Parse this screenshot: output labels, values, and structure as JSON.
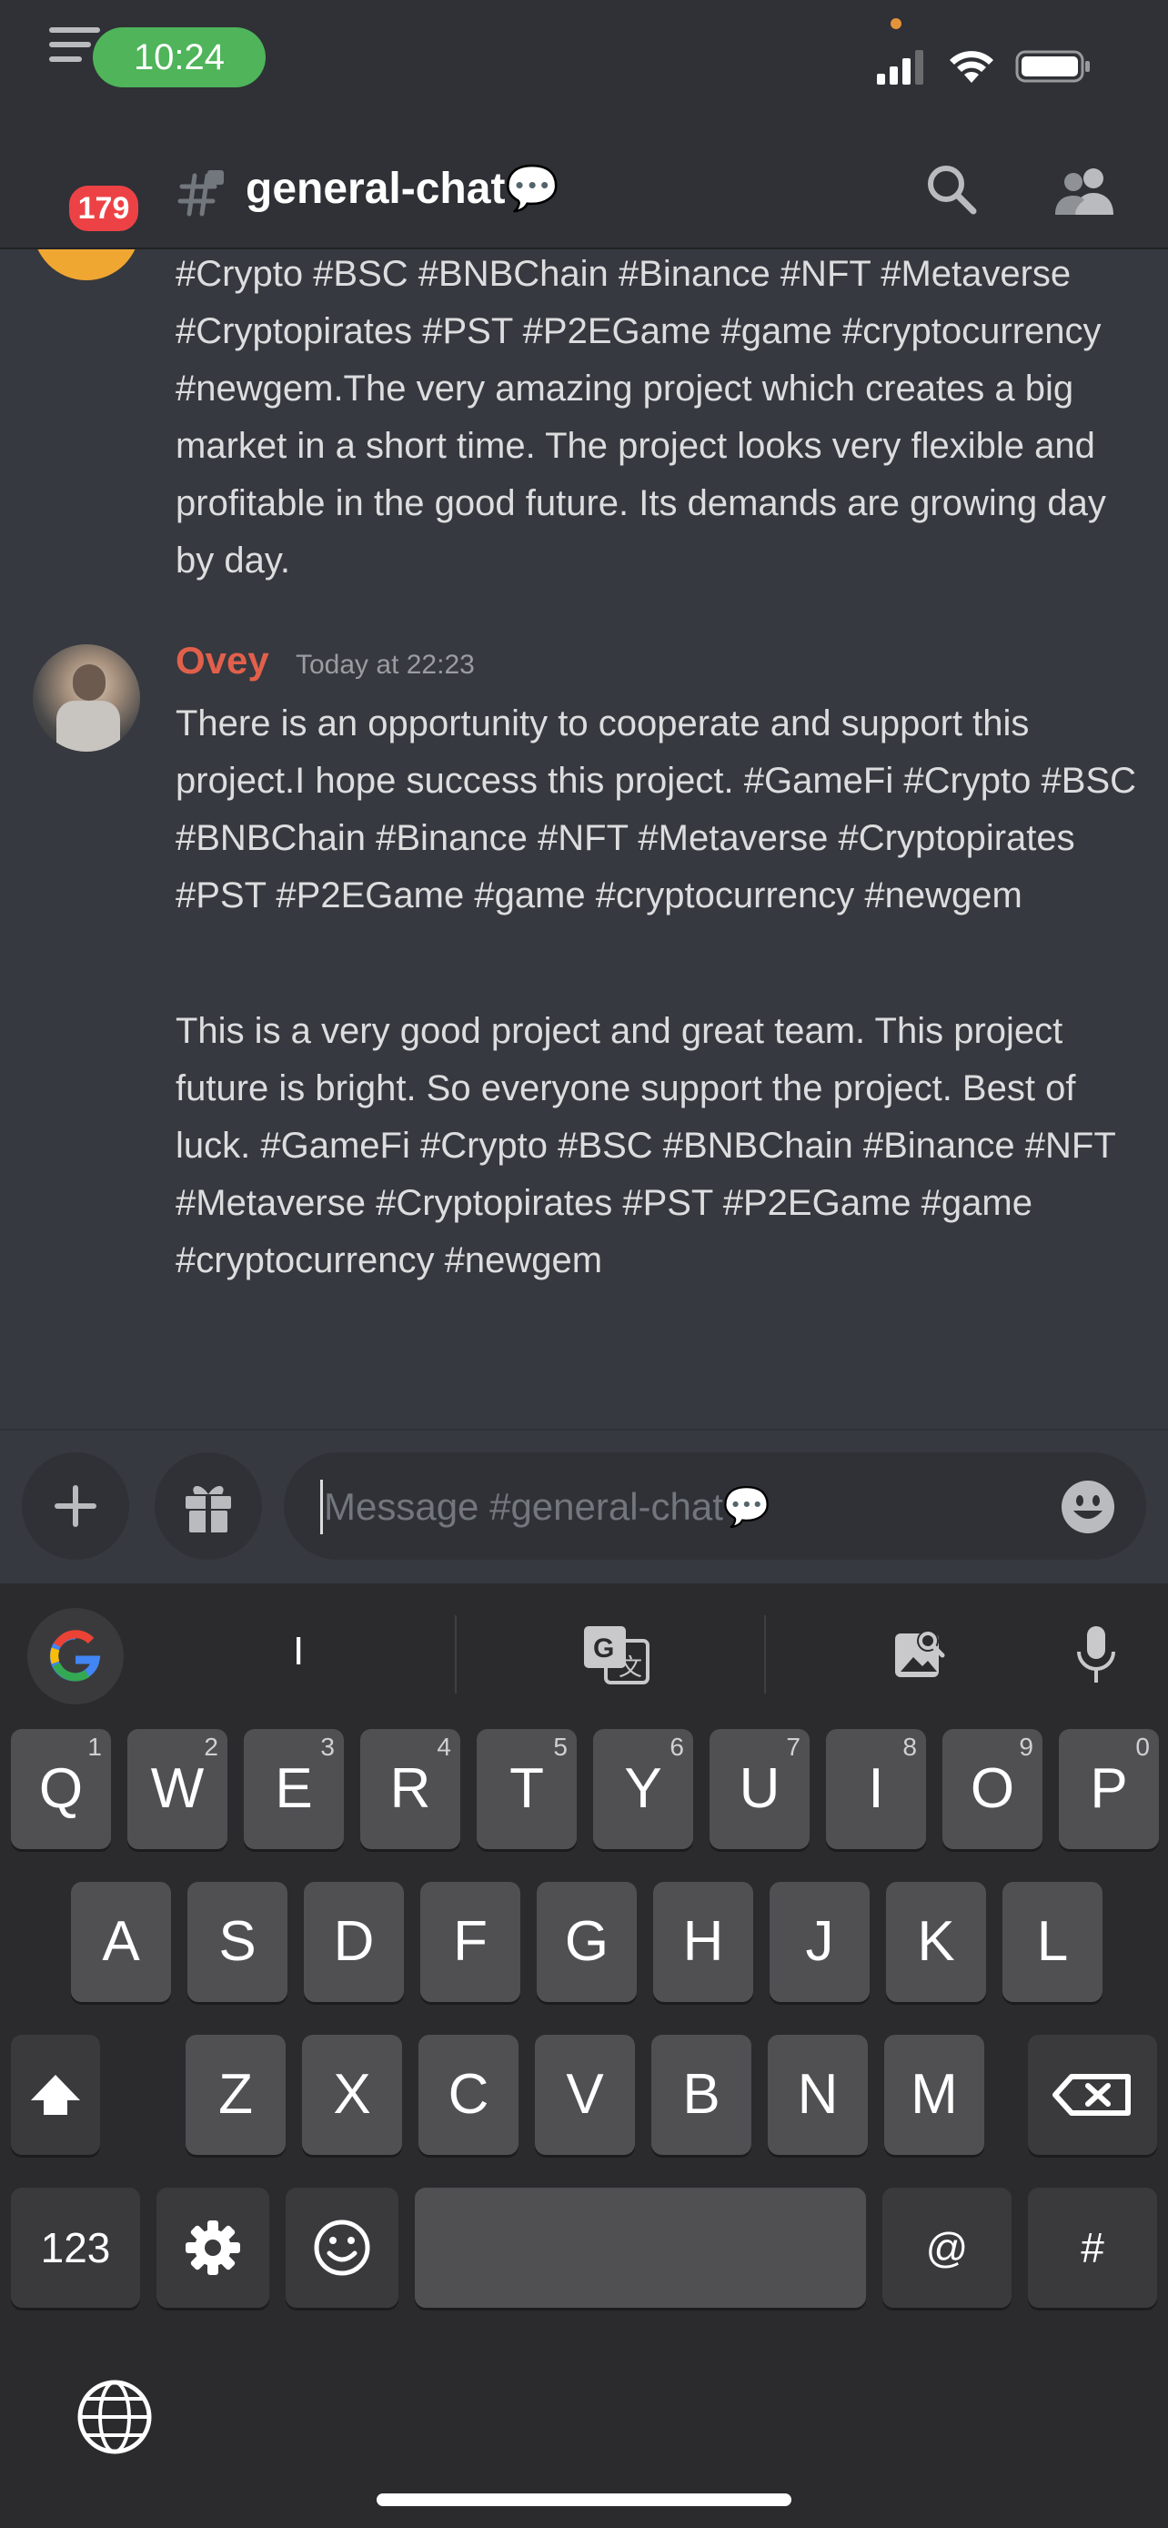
{
  "status_bar": {
    "time": "10:24"
  },
  "header": {
    "unread_badge": "179",
    "channel_name": "general-chat💬"
  },
  "messages": {
    "partial_top_text": "#Crypto #BSC #BNBChain #Binance   #NFT #Metaverse #Cryptopirates #PST #P2EGame #game #cryptocurrency #newgem.The very amazing project which creates a big market in a short time. The project looks very flexible and profitable in the good future. Its demands are growing day by day.",
    "ovey": {
      "author": "Ovey",
      "timestamp": "Today at 22:23",
      "text_1": "There is an opportunity to cooperate and support this project.I hope success this project. #GameFi #Crypto #BSC #BNBChain #Binance #NFT #Metaverse #Cryptopirates #PST #P2EGame #game #cryptocurrency #newgem",
      "text_2": "This is a very good project and great team. This project future is bright. So everyone support the project. Best of luck. #GameFi #Crypto #BSC #BNBChain #Binance #NFT #Metaverse #Cryptopirates #PST #P2EGame #game #cryptocurrency #newgem"
    }
  },
  "composer": {
    "placeholder": "Message #general-chat💬"
  },
  "keyboard": {
    "suggestion": "I",
    "row1": [
      {
        "key": "Q",
        "num": "1"
      },
      {
        "key": "W",
        "num": "2"
      },
      {
        "key": "E",
        "num": "3"
      },
      {
        "key": "R",
        "num": "4"
      },
      {
        "key": "T",
        "num": "5"
      },
      {
        "key": "Y",
        "num": "6"
      },
      {
        "key": "U",
        "num": "7"
      },
      {
        "key": "I",
        "num": "8"
      },
      {
        "key": "O",
        "num": "9"
      },
      {
        "key": "P",
        "num": "0"
      }
    ],
    "row2": [
      "A",
      "S",
      "D",
      "F",
      "G",
      "H",
      "J",
      "K",
      "L"
    ],
    "row3": [
      "Z",
      "X",
      "C",
      "V",
      "B",
      "N",
      "M"
    ],
    "numbers_key": "123",
    "at_key": "@",
    "hash_key": "#"
  },
  "colors": {
    "accent_status": "#4fb45a",
    "badge": "#ed4245",
    "author": "#e2604b"
  }
}
